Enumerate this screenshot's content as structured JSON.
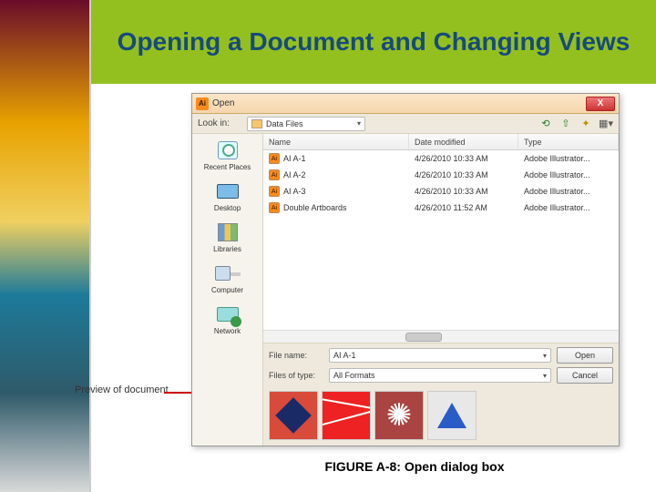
{
  "header": {
    "title": "Opening a Document and Changing Views"
  },
  "annotation": {
    "preview_label": "Preview of document"
  },
  "figure": {
    "caption": "FIGURE A-8: Open dialog box"
  },
  "dialog": {
    "title": "Open",
    "close": "X",
    "lookin_label": "Look in:",
    "lookin_value": "Data Files",
    "toolbar": {
      "back_name": "back-icon",
      "up_name": "up-icon",
      "newfolder_name": "new-folder-icon",
      "views_name": "views-icon"
    },
    "sidebar": {
      "items": [
        {
          "label": "Recent Places"
        },
        {
          "label": "Desktop"
        },
        {
          "label": "Libraries"
        },
        {
          "label": "Computer"
        },
        {
          "label": "Network"
        }
      ]
    },
    "columns": {
      "name": "Name",
      "date": "Date modified",
      "type": "Type"
    },
    "files": [
      {
        "name": "AI A-1",
        "date": "4/26/2010 10:33 AM",
        "type": "Adobe Illustrator..."
      },
      {
        "name": "AI A-2",
        "date": "4/26/2010 10:33 AM",
        "type": "Adobe Illustrator..."
      },
      {
        "name": "AI A-3",
        "date": "4/26/2010 10:33 AM",
        "type": "Adobe Illustrator..."
      },
      {
        "name": "Double Artboards",
        "date": "4/26/2010 11:52 AM",
        "type": "Adobe Illustrator..."
      }
    ],
    "filename_label": "File name:",
    "filename_value": "AI A-1",
    "filetype_label": "Files of type:",
    "filetype_value": "All Formats",
    "open_btn": "Open",
    "cancel_btn": "Cancel"
  }
}
